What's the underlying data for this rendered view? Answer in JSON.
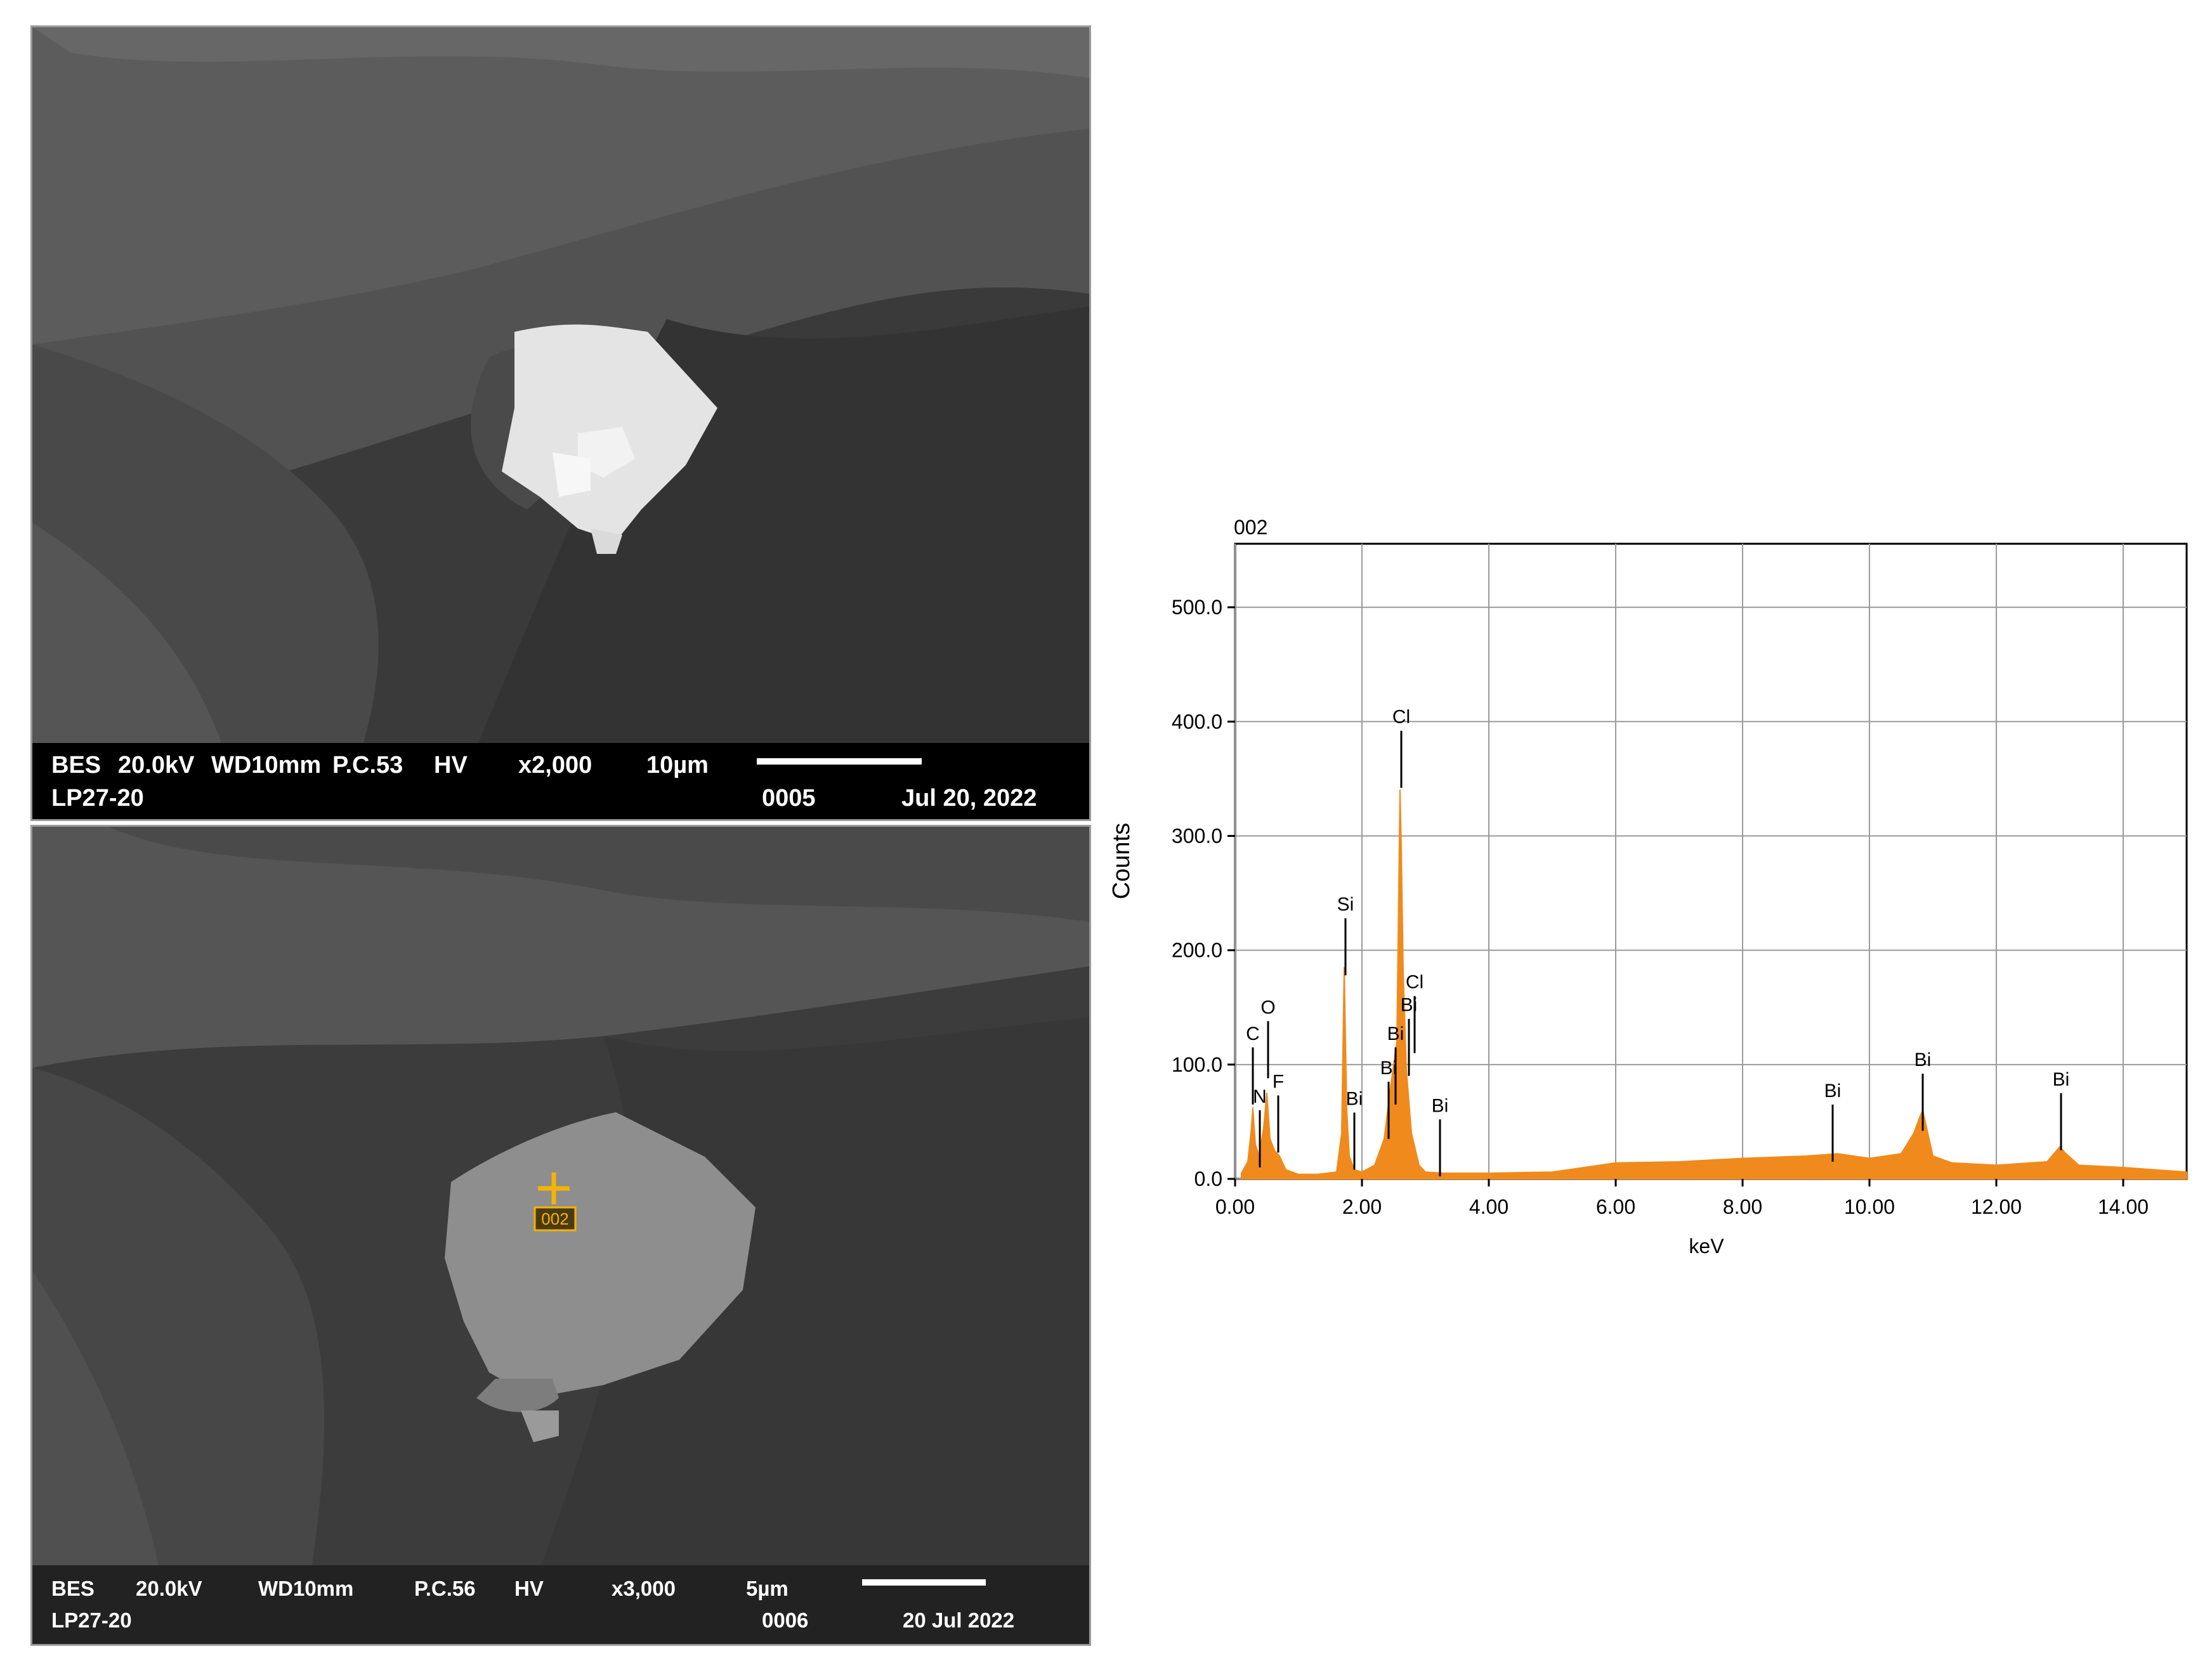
{
  "sem_top": {
    "row1": [
      "BES",
      "20.0kV",
      "WD10mm",
      "P.C.53",
      "HV",
      "x2,000",
      "10µm"
    ],
    "row2": [
      "LP27-20",
      "0005",
      "Jul 20, 2022"
    ]
  },
  "sem_bottom": {
    "row1": [
      "BES",
      "20.0kV",
      "WD10mm",
      "P.C.56",
      "HV",
      "x3,000",
      "5µm"
    ],
    "row2": [
      "LP27-20",
      "0006",
      "20 Jul 2022"
    ],
    "marker_label": "002",
    "marker_color": "#f5b400"
  },
  "chart_data": {
    "type": "line",
    "title": "002",
    "xlabel": "keV",
    "ylabel": "Counts",
    "xlim": [
      0,
      15
    ],
    "ylim": [
      0,
      500
    ],
    "xticks": [
      0,
      2,
      4,
      6,
      8,
      10,
      12,
      14
    ],
    "xtick_labels": [
      "0.00",
      "2.00",
      "4.00",
      "6.00",
      "8.00",
      "10.00",
      "12.00",
      "14.00"
    ],
    "yticks": [
      0,
      100,
      200,
      300,
      400,
      500
    ],
    "ytick_labels": [
      "0.0",
      "100.0",
      "200.0",
      "300.0",
      "400.0",
      "500.0"
    ],
    "grid": true,
    "fill_color": "#f08a1c",
    "series": [
      {
        "x": [
          0.1,
          0.2,
          0.25,
          0.28,
          0.32,
          0.38,
          0.45,
          0.5,
          0.55,
          0.62,
          0.7,
          0.8,
          1.0,
          1.3,
          1.6,
          1.68,
          1.72,
          1.76,
          1.8,
          1.88,
          2.0,
          2.2,
          2.35,
          2.45,
          2.55,
          2.6,
          2.62,
          2.65,
          2.7,
          2.78,
          2.9,
          3.0,
          3.3,
          4.0,
          5.0,
          6.0,
          7.0,
          8.0,
          9.0,
          9.5,
          10.0,
          10.5,
          10.7,
          10.8,
          10.84,
          10.9,
          11.0,
          11.3,
          12.0,
          12.8,
          13.0,
          13.1,
          13.3,
          14.0,
          15.0
        ],
        "y": [
          5,
          15,
          40,
          62,
          30,
          20,
          45,
          75,
          35,
          25,
          20,
          8,
          4,
          4,
          6,
          40,
          185,
          60,
          20,
          8,
          6,
          12,
          35,
          80,
          120,
          340,
          290,
          180,
          95,
          40,
          12,
          6,
          5,
          5,
          6,
          14,
          15,
          18,
          20,
          22,
          18,
          22,
          40,
          55,
          60,
          45,
          20,
          14,
          12,
          15,
          28,
          22,
          12,
          10,
          6
        ]
      }
    ],
    "peak_labels": [
      {
        "label": "C",
        "x": 0.28,
        "marker_y": 115
      },
      {
        "label": "N",
        "x": 0.39,
        "marker_y": 60
      },
      {
        "label": "O",
        "x": 0.52,
        "marker_y": 138
      },
      {
        "label": "F",
        "x": 0.68,
        "marker_y": 73
      },
      {
        "label": "Si",
        "x": 1.74,
        "marker_y": 228
      },
      {
        "label": "Bi",
        "x": 1.88,
        "marker_y": 58
      },
      {
        "label": "Bi",
        "x": 2.42,
        "marker_y": 85
      },
      {
        "label": "Bi",
        "x": 2.53,
        "marker_y": 115
      },
      {
        "label": "Cl",
        "x": 2.62,
        "marker_y": 392
      },
      {
        "label": "Bi",
        "x": 2.74,
        "marker_y": 140
      },
      {
        "label": "Cl",
        "x": 2.83,
        "marker_y": 160
      },
      {
        "label": "Bi",
        "x": 3.23,
        "marker_y": 52
      },
      {
        "label": "Bi",
        "x": 9.42,
        "marker_y": 65
      },
      {
        "label": "Bi",
        "x": 10.84,
        "marker_y": 92
      },
      {
        "label": "Bi",
        "x": 13.02,
        "marker_y": 75
      }
    ]
  }
}
